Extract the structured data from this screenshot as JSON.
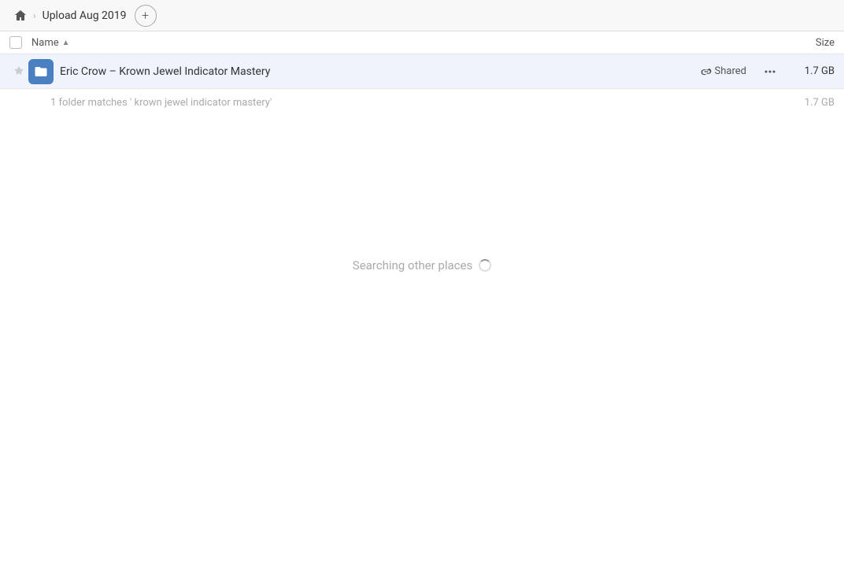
{
  "topbar": {
    "breadcrumb_label": "Upload Aug 2019",
    "add_button_label": "+"
  },
  "columns": {
    "name_label": "Name",
    "size_label": "Size"
  },
  "file_row": {
    "name": "Eric Crow – Krown Jewel Indicator Mastery",
    "shared_label": "Shared",
    "size": "1.7 GB"
  },
  "match_summary": {
    "text": "1 folder matches ' krown jewel indicator mastery'",
    "size": "1.7 GB"
  },
  "searching": {
    "text": "Searching other places"
  }
}
